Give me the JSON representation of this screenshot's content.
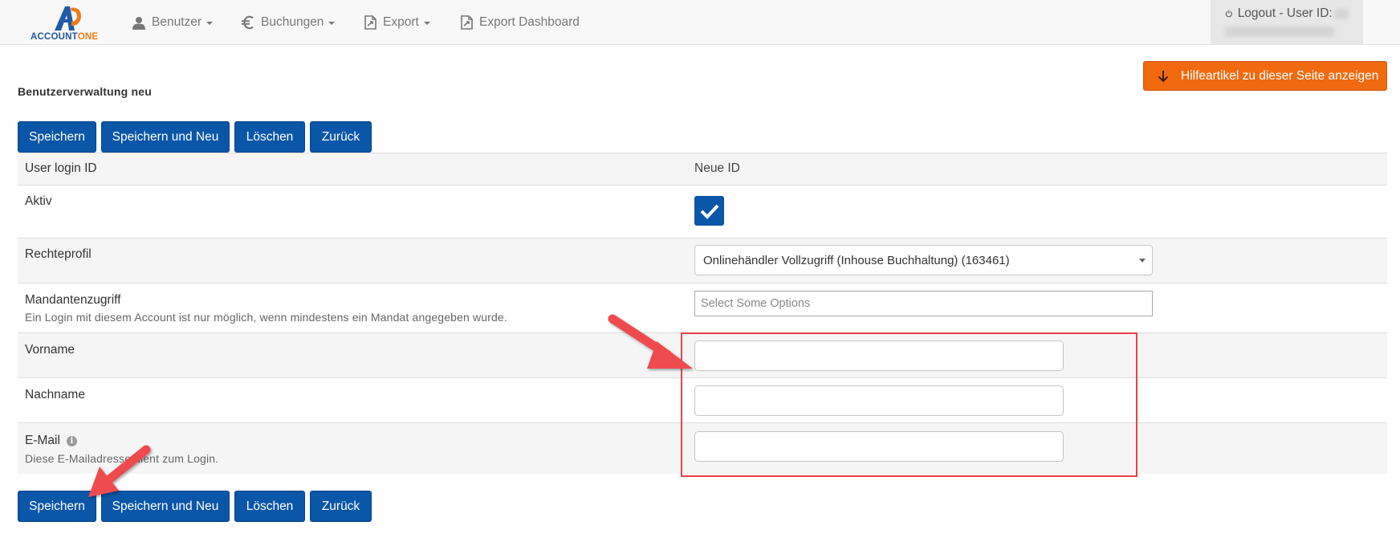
{
  "brand": {
    "name_part1": "ACCOUNT",
    "name_part2": "ONE",
    "primary_color": "#1f5aa6",
    "accent_color": "#f07d1a"
  },
  "nav": {
    "items": [
      {
        "label": "Benutzer",
        "icon": "user-icon",
        "has_caret": true
      },
      {
        "label": "Buchungen",
        "icon": "euro-icon",
        "has_caret": true
      },
      {
        "label": "Export",
        "icon": "file-export-icon",
        "has_caret": true
      },
      {
        "label": "Export Dashboard",
        "icon": "file-export-icon",
        "has_caret": false
      }
    ],
    "logout": {
      "label": "Logout - User ID:",
      "icon": "power-icon"
    }
  },
  "help_button": {
    "label": "Hilfeartikel zu dieser Seite anzeigen",
    "icon": "arrow-down-icon",
    "color": "#f16a0f"
  },
  "page": {
    "title": "Benutzerverwaltung neu"
  },
  "actions": {
    "save": "Speichern",
    "save_new": "Speichern und Neu",
    "delete": "Löschen",
    "back": "Zurück",
    "color": "#0a56a8"
  },
  "form": {
    "user_login_id": {
      "label": "User login ID",
      "value": "Neue ID"
    },
    "aktiv": {
      "label": "Aktiv",
      "checked": true
    },
    "rechteprofil": {
      "label": "Rechteprofil",
      "selected": "Onlinehändler Vollzugriff (Inhouse Buchhaltung) (163461)"
    },
    "mandantenzugriff": {
      "label": "Mandantenzugriff",
      "hint": "Ein Login mit diesem Account ist nur möglich, wenn mindestens ein Mandat angegeben wurde.",
      "placeholder": "Select Some Options"
    },
    "vorname": {
      "label": "Vorname",
      "value": ""
    },
    "nachname": {
      "label": "Nachname",
      "value": ""
    },
    "email": {
      "label": "E-Mail",
      "hint": "Diese E-Mailadresse dient zum Login.",
      "value": "",
      "info_icon": "info-icon"
    }
  },
  "annotation": {
    "color": "#e8414a"
  }
}
